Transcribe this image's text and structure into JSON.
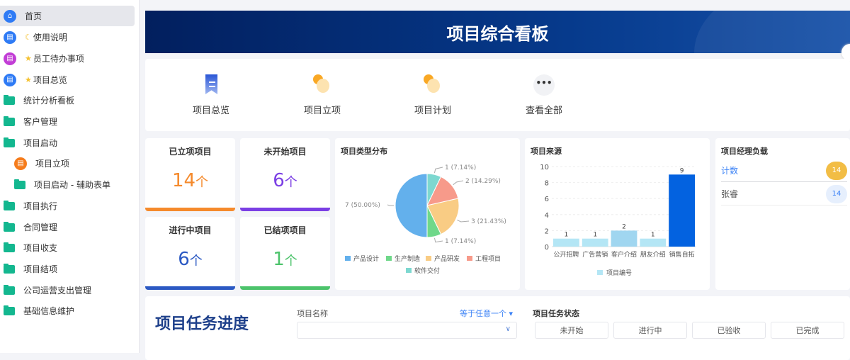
{
  "sidebar": {
    "items": [
      {
        "label": "首页",
        "icon": "home-icon",
        "color": "#2f7bf5"
      },
      {
        "label": "使用说明",
        "icon": "document-icon",
        "color": "#2f7bf5",
        "prefix": "moon"
      },
      {
        "label": "员工待办事项",
        "icon": "monitor-icon",
        "color": "#c23ed6",
        "prefix": "star"
      },
      {
        "label": "项目总览",
        "icon": "document-icon",
        "color": "#2f7bf5",
        "prefix": "star"
      },
      {
        "label": "统计分析看板",
        "icon": "folder-icon"
      },
      {
        "label": "客户管理",
        "icon": "folder-icon"
      },
      {
        "label": "项目启动",
        "icon": "folder-open-icon"
      },
      {
        "label": "项目立项",
        "icon": "document-icon",
        "color": "#f57c1c"
      },
      {
        "label": "项目启动 - 辅助表单",
        "icon": "folder-icon"
      },
      {
        "label": "项目执行",
        "icon": "folder-icon"
      },
      {
        "label": "合同管理",
        "icon": "folder-icon"
      },
      {
        "label": "项目收支",
        "icon": "folder-icon"
      },
      {
        "label": "项目结项",
        "icon": "folder-icon"
      },
      {
        "label": "公司运营支出管理",
        "icon": "folder-icon"
      },
      {
        "label": "基础信息维护",
        "icon": "folder-icon"
      }
    ]
  },
  "banner": {
    "title": "项目综合看板"
  },
  "shortcuts": [
    {
      "label": "项目总览"
    },
    {
      "label": "项目立项"
    },
    {
      "label": "项目计划"
    },
    {
      "label": "查看全部"
    }
  ],
  "stats": [
    {
      "title": "已立项项目",
      "value": "14",
      "unit": "个",
      "color": "#f58a2c"
    },
    {
      "title": "未开始项目",
      "value": "6",
      "unit": "个",
      "color": "#7b3fe4"
    },
    {
      "title": "进行中项目",
      "value": "6",
      "unit": "个",
      "color": "#2b59c3"
    },
    {
      "title": "已结项项目",
      "value": "1",
      "unit": "个",
      "color": "#4cc36b"
    }
  ],
  "chart_data": [
    {
      "type": "pie",
      "title": "项目类型分布",
      "slices": [
        {
          "name": "软件交付",
          "value": 1,
          "label": "1 (7.14%)",
          "color": "#7dd8d0"
        },
        {
          "name": "工程项目",
          "value": 2,
          "label": "2 (14.29%)",
          "color": "#f79a8a"
        },
        {
          "name": "产品研发",
          "value": 3,
          "label": "3 (21.43%)",
          "color": "#f9cc84"
        },
        {
          "name": "生产制造",
          "value": 1,
          "label": "1 (7.14%)",
          "color": "#6fd88a"
        },
        {
          "name": "产品设计",
          "value": 7,
          "label": "7 (50.00%)",
          "color": "#63b0ec"
        }
      ],
      "legend": [
        "产品设计",
        "生产制造",
        "产品研发",
        "工程项目",
        "软件交付"
      ]
    },
    {
      "type": "bar",
      "title": "项目来源",
      "categories": [
        "公开招聘",
        "广告营销",
        "客户介绍",
        "朋友介绍",
        "销售自拓"
      ],
      "values": [
        1,
        1,
        2,
        1,
        9
      ],
      "colors": [
        "#b4e6f5",
        "#b4e6f5",
        "#a0d6f0",
        "#b4e6f5",
        "#0362e0"
      ],
      "yticks": [
        0,
        2,
        4,
        6,
        8,
        10
      ],
      "ylim": [
        0,
        10
      ],
      "legend": "项目编号"
    }
  ],
  "manager": {
    "title": "项目经理负载",
    "rows": [
      {
        "name": "计数",
        "value": "14"
      },
      {
        "name": "张睿",
        "value": "14"
      }
    ]
  },
  "tasks": {
    "title": "项目任务进度",
    "field_label": "项目名称",
    "filter": "等于任意一个",
    "input_value": "",
    "status_label": "项目任务状态",
    "statuses": [
      "未开始",
      "进行中",
      "已验收",
      "已完成"
    ]
  }
}
